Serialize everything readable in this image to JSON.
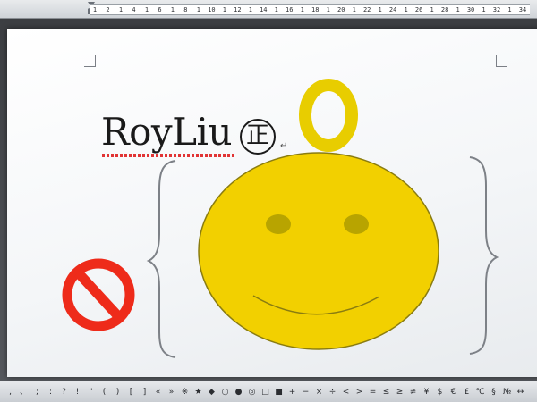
{
  "ruler": {
    "ticks": [
      "1",
      "2",
      "1",
      "4",
      "1",
      "6",
      "1",
      "8",
      "1",
      "10",
      "1",
      "12",
      "1",
      "14",
      "1",
      "16",
      "1",
      "18",
      "1",
      "20",
      "1",
      "22",
      "1",
      "24",
      "1",
      "26",
      "1",
      "28",
      "1",
      "30",
      "1",
      "32",
      "1",
      "34"
    ]
  },
  "document": {
    "text": "RoyLiu",
    "enclosed_char": "正",
    "paragraph_mark": "↵"
  },
  "shapes": {
    "face_color": "#f2d000",
    "face_stroke": "#8a7c10",
    "eye_color": "#b8a400",
    "ring_color": "#e8cd00",
    "prohibited_color": "#ee2b1a",
    "brace_color": "#7d8187"
  },
  "symbol_toolbar": {
    "symbols": [
      ",",
      "、",
      ";",
      ":",
      "?",
      "!",
      "\"",
      "(",
      ")",
      "[",
      "]",
      "«",
      "»",
      "※",
      "★",
      "◆",
      "○",
      "●",
      "◎",
      "□",
      "■",
      "+",
      "−",
      "×",
      "÷",
      "<",
      ">",
      "=",
      "≤",
      "≥",
      "≠",
      "¥",
      "$",
      "€",
      "£",
      "℃",
      "§",
      "№",
      "↔"
    ]
  }
}
